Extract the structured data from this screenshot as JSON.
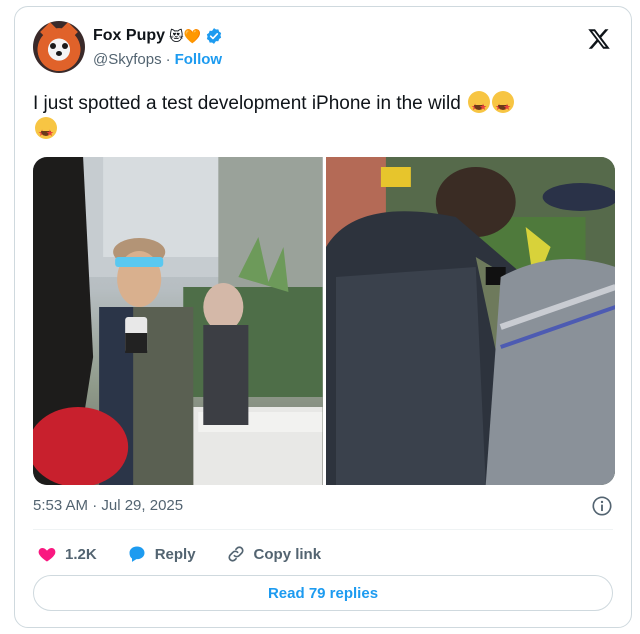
{
  "author": {
    "display_name": "Fox Pupy",
    "name_emojis": "😻🧡",
    "handle": "@Skyfops",
    "separator": "·",
    "follow_label": "Follow"
  },
  "tweet": {
    "text": "I just spotted a test development iPhone in the wild",
    "emoji": "🤩🤩🤩",
    "timestamp": "5:53 AM · Jul 29, 2025"
  },
  "actions": {
    "like_count": "1.2K",
    "reply_label": "Reply",
    "copy_link_label": "Copy link"
  },
  "read_replies_label": "Read 79 replies",
  "colors": {
    "accent": "#1d9bf0",
    "like": "#f91880",
    "text_secondary": "#536471",
    "border": "#cfd9de"
  },
  "icons": {
    "platform": "x-logo-icon",
    "verified": "verified-badge-icon",
    "info": "info-icon",
    "like": "heart-icon",
    "reply": "reply-bubble-icon",
    "copy": "link-icon"
  }
}
